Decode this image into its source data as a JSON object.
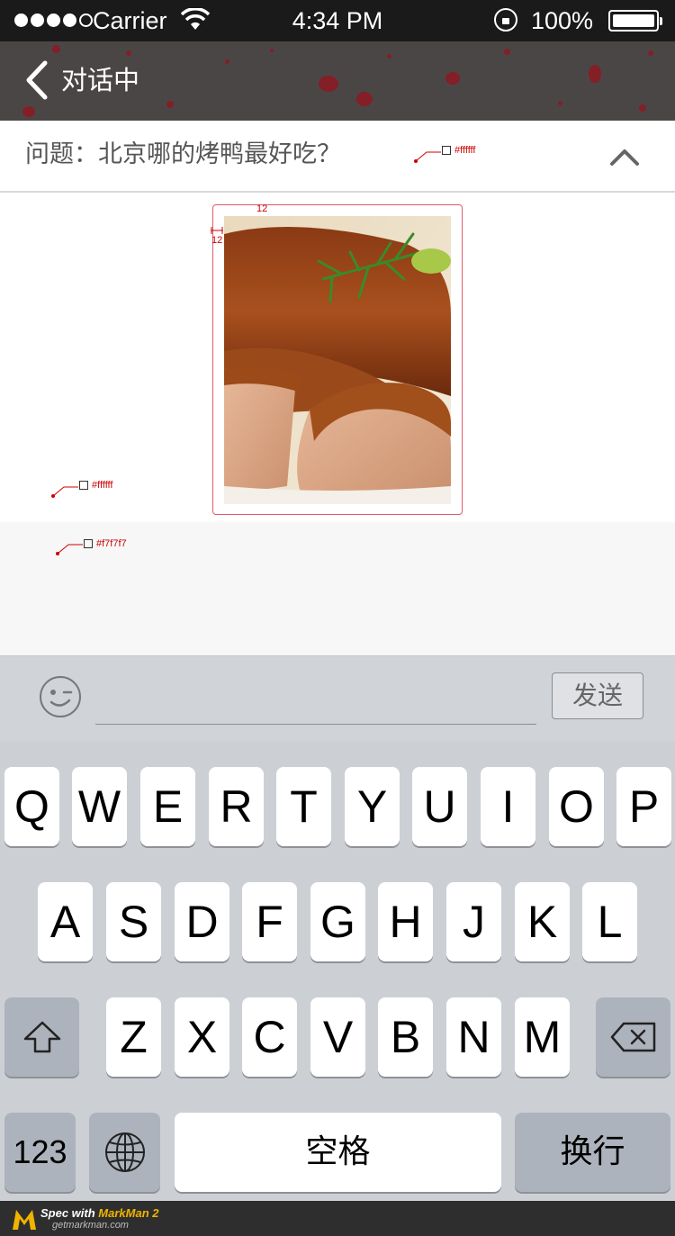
{
  "status_bar": {
    "carrier": "Carrier",
    "time": "4:34 PM",
    "battery": "100%",
    "battery_level": 1.0,
    "signal_bars": 4
  },
  "nav": {
    "back_icon": "chevron-left-icon",
    "title": "对话中"
  },
  "question": {
    "text": "问题：北京哪的烤鸭最好吃？",
    "collapse_icon": "chevron-up-icon"
  },
  "chat": {
    "image_alt": "roast duck"
  },
  "annotations": {
    "header_bg": "#ffffff",
    "chat_bg": "#ffffff",
    "empty_bg": "#f7f7f7",
    "padding_top": "12",
    "padding_left": "12"
  },
  "input_bar": {
    "emoji_icon": "emoji-wink-icon",
    "placeholder": "",
    "send_label": "发送"
  },
  "keyboard": {
    "row1": [
      "Q",
      "W",
      "E",
      "R",
      "T",
      "Y",
      "U",
      "I",
      "O",
      "P"
    ],
    "row2": [
      "A",
      "S",
      "D",
      "F",
      "G",
      "H",
      "J",
      "K",
      "L"
    ],
    "row3": [
      "Z",
      "X",
      "C",
      "V",
      "B",
      "N",
      "M"
    ],
    "shift_icon": "shift-icon",
    "delete_icon": "backspace-icon",
    "numbers_label": "123",
    "globe_icon": "globe-icon",
    "space_label": "空格",
    "return_label": "换行"
  },
  "footer": {
    "spec_prefix": "Spec with ",
    "brand": "MarkMan 2",
    "site": "getmarkman.com"
  },
  "colors": {
    "nav_bg": "#4b4646",
    "accent_red": "#cc0000",
    "keyboard_bg": "#ccd0d5"
  }
}
